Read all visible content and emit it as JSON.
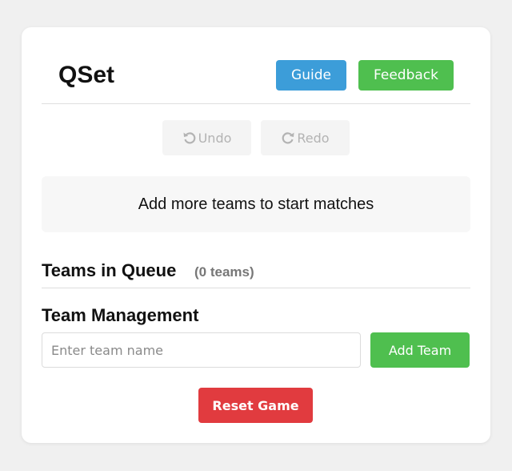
{
  "app": {
    "title": "QSet"
  },
  "header": {
    "guide_label": "Guide",
    "feedback_label": "Feedback"
  },
  "history": {
    "undo_label": "Undo",
    "redo_label": "Redo"
  },
  "notice": {
    "text": "Add more teams to start matches"
  },
  "queue": {
    "title": "Teams in Queue",
    "count_text": "(0 teams)"
  },
  "management": {
    "title": "Team Management",
    "input_placeholder": "Enter team name",
    "add_label": "Add Team"
  },
  "reset": {
    "label": "Reset Game"
  },
  "colors": {
    "guide": "#3c9dd9",
    "feedback": "#4fbf4f",
    "add_team": "#4fbf4f",
    "reset": "#e13b3f",
    "background": "#f0f0f0"
  },
  "icons": {
    "undo": "rotate-ccw-icon",
    "redo": "rotate-cw-icon"
  }
}
